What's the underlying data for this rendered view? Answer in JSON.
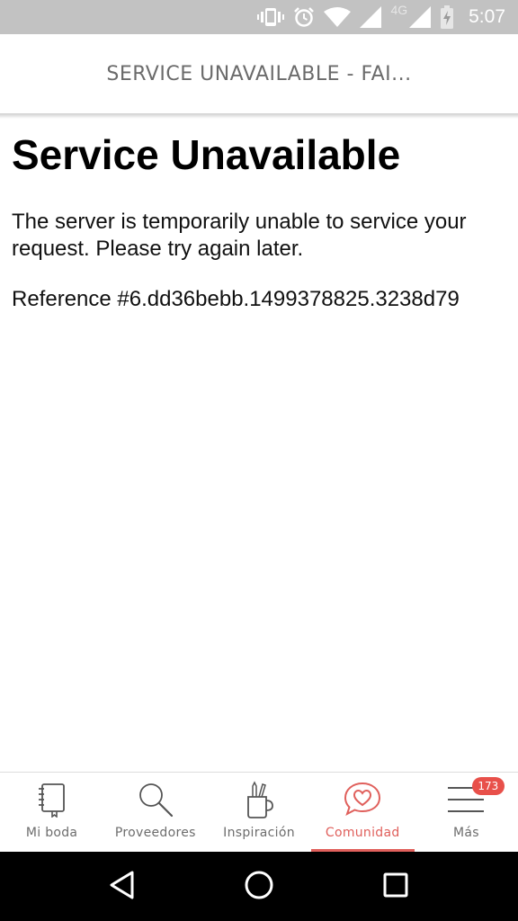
{
  "status_bar": {
    "time": "5:07",
    "network_type": "4G",
    "icons": [
      "vibrate-icon",
      "alarm-icon",
      "wifi-icon",
      "signal-icon",
      "signal-icon",
      "battery-charging-icon"
    ]
  },
  "header": {
    "title": "SERVICE UNAVAILABLE - FAI..."
  },
  "page": {
    "heading": "Service Unavailable",
    "message": "The server is temporarily unable to service your request. Please try again later.",
    "reference": "Reference #6.dd36bebb.1499378825.3238d79"
  },
  "tab_bar": {
    "tabs": [
      {
        "label": "Mi boda",
        "icon": "notebook-icon",
        "active": false
      },
      {
        "label": "Proveedores",
        "icon": "search-icon",
        "active": false
      },
      {
        "label": "Inspiración",
        "icon": "pencil-cup-icon",
        "active": false
      },
      {
        "label": "Comunidad",
        "icon": "heart-chat-icon",
        "active": true
      },
      {
        "label": "Más",
        "icon": "menu-icon",
        "active": false,
        "badge": "173"
      }
    ]
  },
  "nav_bar": {
    "buttons": [
      "back-icon",
      "home-icon",
      "recents-icon"
    ]
  },
  "colors": {
    "accent": "#e0605c",
    "badge": "#e8504a",
    "status_bar": "#c2c2c2",
    "tab_label": "#6d6d6d"
  }
}
